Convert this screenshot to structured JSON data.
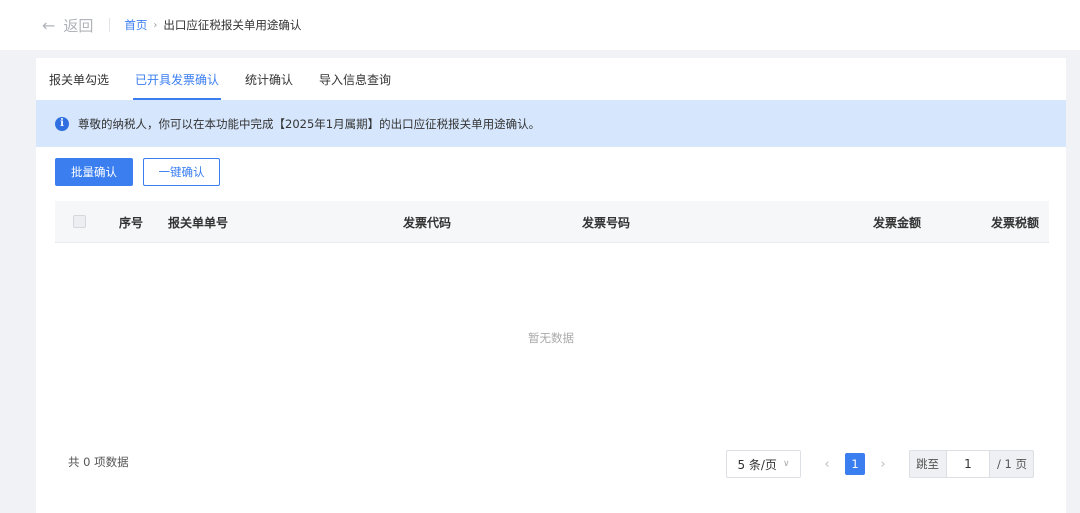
{
  "header": {
    "back_arrow": "←",
    "back_label": "返回",
    "breadcrumb_home": "首页",
    "breadcrumb_sep": "›",
    "breadcrumb_current": "出口应征税报关单用途确认"
  },
  "tabs": [
    {
      "label": "报关单勾选",
      "active": false
    },
    {
      "label": "已开具发票确认",
      "active": true
    },
    {
      "label": "统计确认",
      "active": false
    },
    {
      "label": "导入信息查询",
      "active": false
    }
  ],
  "notice": {
    "icon": "i",
    "text": "尊敬的纳税人，你可以在本功能中完成【2025年1月属期】的出口应征税报关单用途确认。"
  },
  "buttons": {
    "batch_confirm": "批量确认",
    "one_click_confirm": "一键确认"
  },
  "table": {
    "columns": [
      "序号",
      "报关单单号",
      "发票代码",
      "发票号码",
      "发票金额",
      "发票税额"
    ],
    "rows": [],
    "empty_text": "暂无数据"
  },
  "footer": {
    "total_text": "共 0 项数据",
    "page_size": "5 条/页",
    "page_size_chevron": "∨",
    "prev": "‹",
    "current_page": "1",
    "next": "›",
    "jump_label": "跳至",
    "jump_value": "1",
    "total_pages": "/ 1 页"
  },
  "colors": {
    "accent": "#3a7ef0",
    "notice_bg": "#d6e7fd",
    "page_bg": "#f0f2f5"
  }
}
